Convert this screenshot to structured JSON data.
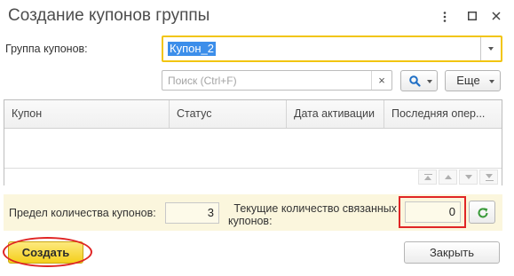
{
  "window": {
    "title": "Создание купонов группы",
    "menu_icon": "vertical-dots-icon",
    "maximize_icon": "maximize-icon",
    "close_icon": "close-icon"
  },
  "group": {
    "label": "Группа купонов:",
    "value": "Купон_2"
  },
  "search": {
    "placeholder": "Поиск (Ctrl+F)",
    "clear_glyph": "×",
    "find_icon": "search-icon"
  },
  "toolbar": {
    "more_label": "Еще"
  },
  "table": {
    "columns": [
      "Купон",
      "Статус",
      "Дата активации",
      "Последняя опер..."
    ],
    "rows": []
  },
  "limits": {
    "limit_label": "Предел количества купонов:",
    "limit_value": "3",
    "current_label_line1": "Текущие количество связанных",
    "current_label_line2": "купонов:",
    "current_value": "0"
  },
  "actions": {
    "create_label": "Создать",
    "close_label": "Закрыть"
  },
  "colors": {
    "accent_yellow": "#f4cf1b",
    "selection_blue": "#3c8eea",
    "highlight_red": "#e02525",
    "refresh_green": "#3a9a3a"
  }
}
